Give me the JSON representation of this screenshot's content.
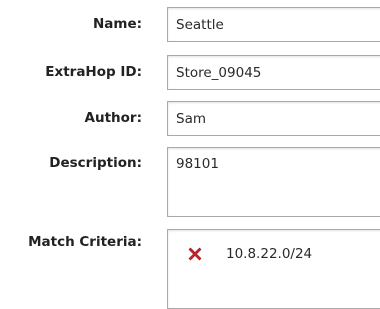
{
  "form": {
    "name": {
      "label": "Name:",
      "value": "Seattle"
    },
    "extrahop_id": {
      "label": "ExtraHop ID:",
      "value": "Store_09045"
    },
    "author": {
      "label": "Author:",
      "value": "Sam"
    },
    "description": {
      "label": "Description:",
      "value": "98101"
    },
    "match_criteria": {
      "label": "Match Criteria:",
      "items": [
        {
          "value": "10.8.22.0/24",
          "remove_icon": "red-x-icon"
        }
      ]
    }
  },
  "colors": {
    "remove_icon": "#c8242b",
    "field_border": "#a9a9a9",
    "label_text": "#222222"
  }
}
